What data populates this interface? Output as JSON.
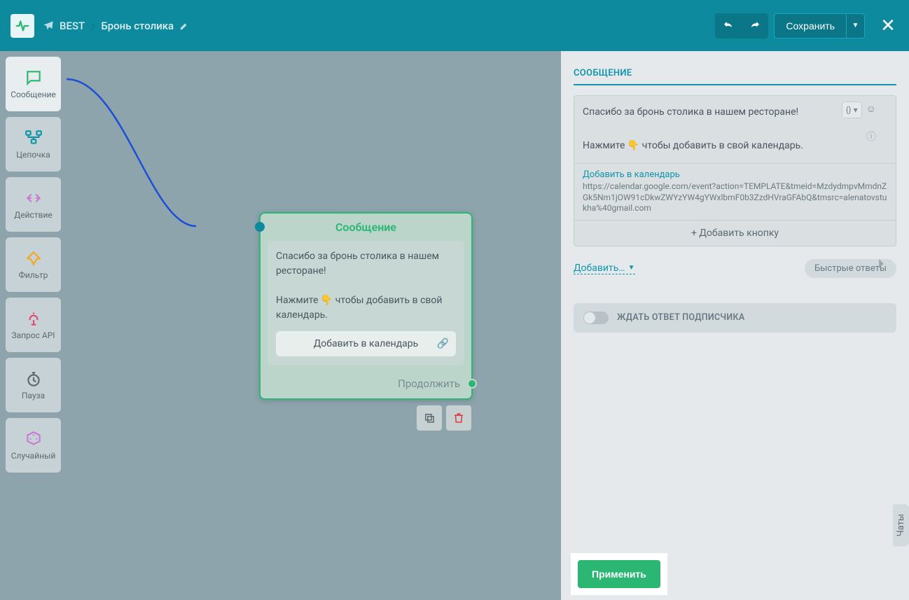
{
  "header": {
    "bot_name": "BEST",
    "flow_name": "Бронь столика",
    "save_label": "Сохранить"
  },
  "toolbox": {
    "message": "Сообщение",
    "chain": "Цепочка",
    "action": "Действие",
    "filter": "Фильтр",
    "api": "Запрос API",
    "pause": "Пауза",
    "random": "Случайный"
  },
  "node": {
    "title": "Сообщение",
    "text_line1": "Спасибо за бронь столика в нашем ресторане!",
    "text_line2": "Нажмите 👇 чтобы добавить в свой календарь.",
    "button_label": "Добавить в календарь",
    "continue": "Продолжить"
  },
  "panel": {
    "title": "СООБЩЕНИЕ",
    "text_line1": "Спасибо за бронь столика в нашем ресторане!",
    "text_line2": "Нажмите 👇 чтобы добавить в свой календарь.",
    "variable_btn": "{} ▾",
    "button": {
      "title": "Добавить в календарь",
      "url": "https://calendar.google.com/event?action=TEMPLATE&tmeid=MzdydmpvMmdnZGk5Nm1jOW91cDkwZWYzYW4gYWxlbmF0b3ZzdHVraGFAbQ&tmsrc=alenatovstukha%40gmail.com"
    },
    "add_button": "+ Добавить кнопку",
    "add_dropdown": "Добавить…",
    "quick_replies": "Быстрые ответы",
    "wait_label": "ЖДАТЬ ОТВЕТ ПОДПИСЧИКА",
    "apply": "Применить"
  },
  "chats_tab": "Чаты"
}
